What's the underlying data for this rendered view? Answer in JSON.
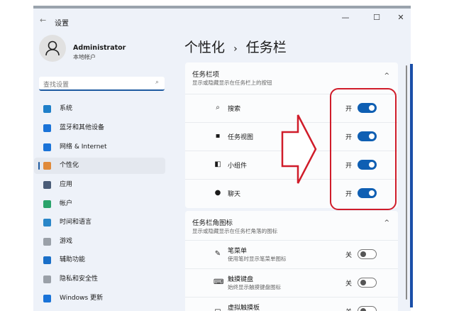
{
  "window": {
    "title": "设置",
    "back": "←",
    "minimize": "—",
    "maximize": "☐",
    "close": "✕"
  },
  "user": {
    "name": "Administrator",
    "type": "本地帐户"
  },
  "search": {
    "placeholder": "查找设置",
    "icon": "⌕"
  },
  "nav": [
    {
      "label": "系统",
      "color": "#1f7fc9"
    },
    {
      "label": "蓝牙和其他设备",
      "color": "#1a73d8"
    },
    {
      "label": "网络 & Internet",
      "color": "#1a73d8"
    },
    {
      "label": "个性化",
      "color": "#e08a3a"
    },
    {
      "label": "应用",
      "color": "#4a5c78"
    },
    {
      "label": "帐户",
      "color": "#2aa36b"
    },
    {
      "label": "时间和语言",
      "color": "#2a86c8"
    },
    {
      "label": "游戏",
      "color": "#9aa0a8"
    },
    {
      "label": "辅助功能",
      "color": "#1a6fc8"
    },
    {
      "label": "隐私和安全性",
      "color": "#9aa0a8"
    },
    {
      "label": "Windows 更新",
      "color": "#1a73d8"
    }
  ],
  "breadcrumb": {
    "parent": "个性化",
    "sep": "›",
    "current": "任务栏"
  },
  "taskbar_items": {
    "title": "任务栏项",
    "subtitle": "显示或隐藏显示在任务栏上的按钮",
    "chevron": "^",
    "items": [
      {
        "label": "搜索",
        "icon": "⌕",
        "state": "开",
        "on": true
      },
      {
        "label": "任务视图",
        "icon": "▪",
        "state": "开",
        "on": true
      },
      {
        "label": "小组件",
        "icon": "◧",
        "state": "开",
        "on": true
      },
      {
        "label": "聊天",
        "icon": "●",
        "state": "开",
        "on": true
      }
    ]
  },
  "corner_icons": {
    "title": "任务栏角图标",
    "subtitle": "显示或隐藏显示在任务栏角落的图标",
    "chevron": "^",
    "items": [
      {
        "label": "笔菜单",
        "sub": "使用笔时显示笔菜单图标",
        "icon": "✎",
        "state": "关",
        "on": false
      },
      {
        "label": "触摸键盘",
        "sub": "始终显示触摸键盘图标",
        "icon": "⌨",
        "state": "关",
        "on": false
      },
      {
        "label": "虚拟触摸板",
        "icon": "▭",
        "state": "关",
        "on": false
      }
    ]
  }
}
